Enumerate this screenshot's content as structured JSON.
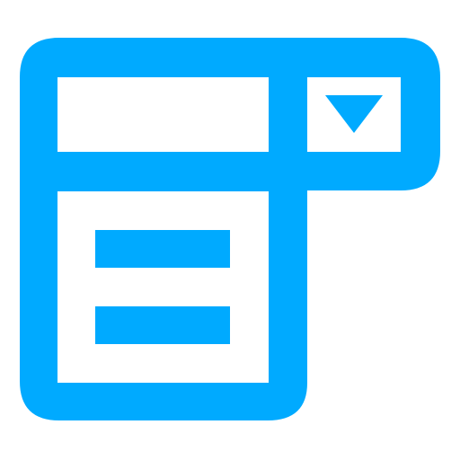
{
  "icon": {
    "name": "dropdown-list-icon",
    "color": "#00AAFF",
    "background": "#FFFFFF",
    "elements": {
      "outer_frame": "dropdown-frame",
      "input_field": "input-field",
      "dropdown_button": "dropdown-button",
      "dropdown_arrow": "chevron-down-icon",
      "dropdown_list": "dropdown-list-panel",
      "list_items": [
        "list-item-line-1",
        "list-item-line-2"
      ]
    }
  }
}
